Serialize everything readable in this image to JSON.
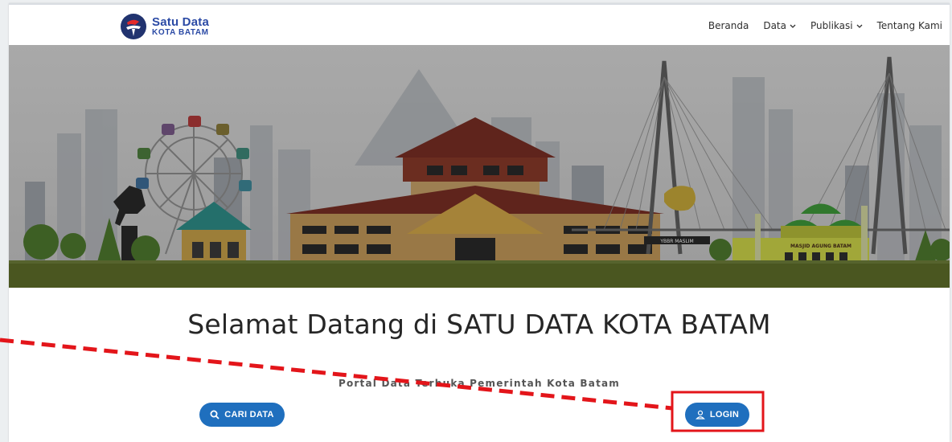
{
  "brand": {
    "line1": "Satu Data",
    "line2": "KOTA BATAM"
  },
  "nav": {
    "items": [
      {
        "label": "Beranda",
        "dropdown": false
      },
      {
        "label": "Data",
        "dropdown": true
      },
      {
        "label": "Publikasi",
        "dropdown": true
      },
      {
        "label": "Tentang Kami",
        "dropdown": false
      }
    ]
  },
  "hero": {
    "illustration": "batam-city-skyline",
    "sign_left": "YBBR MASLIM",
    "sign_right": "MASJID AGUNG BATAM"
  },
  "main": {
    "title": "Selamat Datang di SATU DATA KOTA BATAM",
    "subtitle": "Portal Data Terbuka Pemerintah Kota Batam",
    "search_button": "CARI DATA",
    "login_button": "LOGIN"
  },
  "icons": {
    "search": "search-icon",
    "login": "user-icon",
    "logo": "satu-data-logo-icon"
  },
  "colors": {
    "brand_blue": "#2b4aa5",
    "button_blue": "#1f6fbe",
    "annotation_red": "#e3151a"
  }
}
